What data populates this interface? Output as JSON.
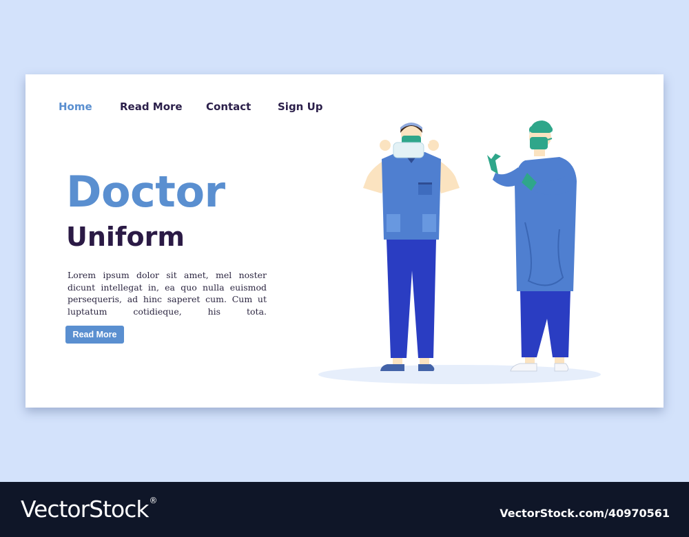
{
  "nav": {
    "items": [
      {
        "label": "Home",
        "active": true
      },
      {
        "label": "Read More",
        "active": false
      },
      {
        "label": "Contact",
        "active": false
      },
      {
        "label": "Sign Up",
        "active": false
      }
    ]
  },
  "hero": {
    "title_line1": "Doctor",
    "title_line2": "Uniform",
    "description": "Lorem ipsum dolor sit amet, mel noster dicunt intellegat in, ea quo nulla euismod persequeris, ad hinc saperet cum. Cum ut luptatum cotidieque, his tota.",
    "button_label": "Read More"
  },
  "footer": {
    "brand": "VectorStock",
    "registered_mark": "®",
    "stock_id": "VectorStock.com/40970561"
  },
  "colors": {
    "accent": "#5a8fd0",
    "heading_dark": "#2b1a45",
    "page_background": "#d3e2fb",
    "footer_background": "#0f1628"
  },
  "icons": [
    "doctor-scrubs-illustration",
    "surgeon-gown-illustration"
  ]
}
